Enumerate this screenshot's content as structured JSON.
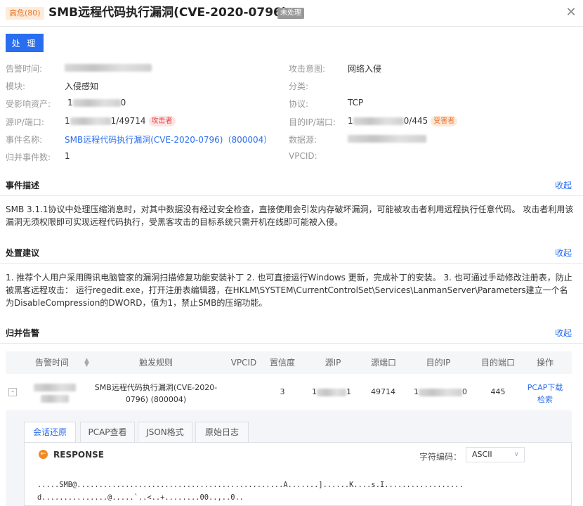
{
  "header": {
    "severity": "高危(80)",
    "title": "SMB远程代码执行漏洞(CVE-2020-0796)",
    "status": "未处理",
    "close_symbol": "✕"
  },
  "handle_button": "处 理",
  "info": {
    "alert_time_label": "告警时间:",
    "attack_intent_label": "攻击意图:",
    "attack_intent_value": "网络入侵",
    "module_label": "模块:",
    "module_value": "入侵感知",
    "category_label": "分类:",
    "asset_label": "受影响资产:",
    "asset_prefix": "1",
    "asset_suffix": "0",
    "protocol_label": "协议:",
    "protocol_value": "TCP",
    "src_label": "源IP/端口:",
    "src_prefix": "1",
    "src_suffix": "1/49714",
    "attacker_tag": "攻击者",
    "dst_label": "目的IP/端口:",
    "dst_prefix": "1",
    "dst_suffix": "0/445",
    "victim_tag": "受害者",
    "event_label": "事件名称:",
    "event_value": "SMB远程代码执行漏洞(CVE-2020-0796)（800004）",
    "datasource_label": "数据源:",
    "merged_label": "归并事件数:",
    "merged_value": "1",
    "vpcid_label": "VPCID:"
  },
  "sections": {
    "description_title": "事件描述",
    "description_text": "SMB 3.1.1协议中处理压缩消息时，对其中数据没有经过安全检查，直接使用会引发内存破坏漏洞，可能被攻击者利用远程执行任意代码。 攻击者利用该漏洞无须权限即可实现远程代码执行，受黑客攻击的目标系统只需开机在线即可能被入侵。",
    "advice_title": "处置建议",
    "advice_text": "1. 推荐个人用户采用腾讯电脑管家的漏洞扫描修复功能安装补丁 2. 也可直接运行Windows 更新，完成补丁的安装。 3. 也可通过手动修改注册表，防止被黑客远程攻击： 运行regedit.exe，打开注册表编辑器，在HKLM\\SYSTEM\\CurrentControlSet\\Services\\LanmanServer\\Parameters建立一个名为DisableCompression的DWORD，值为1，禁止SMB的压缩功能。",
    "merged_title": "归并告警",
    "collapse_label": "收起"
  },
  "table": {
    "columns": [
      "告警时间",
      "触发规则",
      "VPCID",
      "置信度",
      "源IP",
      "源端口",
      "目的IP",
      "目的端口",
      "操作"
    ],
    "row": {
      "expand": "-",
      "rule_line1": "SMB远程代码执行漏洞(CVE-2020-",
      "rule_line2": "0796) (800004)",
      "vpcid": "",
      "confidence": "3",
      "src_ip_prefix": "1",
      "src_ip_suffix": "1",
      "src_port": "49714",
      "dst_ip_prefix": "1",
      "dst_ip_suffix": "0",
      "dst_port": "445",
      "action_pcap": "PCAP下载",
      "action_search": "检索"
    }
  },
  "detail": {
    "tabs": [
      "会话还原",
      "PCAP查看",
      "JSON格式",
      "原始日志"
    ],
    "active_tab": 0,
    "response_label": "RESPONSE",
    "encoding_label": "字符编码：",
    "encoding_value": "ASCII",
    "hex_line1": ".....SMB@...............................................A.......]......K....s.I..................",
    "hex_line2": "d...............@.....`..<..+........00..,..0.."
  },
  "colors": {
    "primary": "#2a6ef0",
    "severity": "#e6772e",
    "attacker": "#e54545"
  }
}
